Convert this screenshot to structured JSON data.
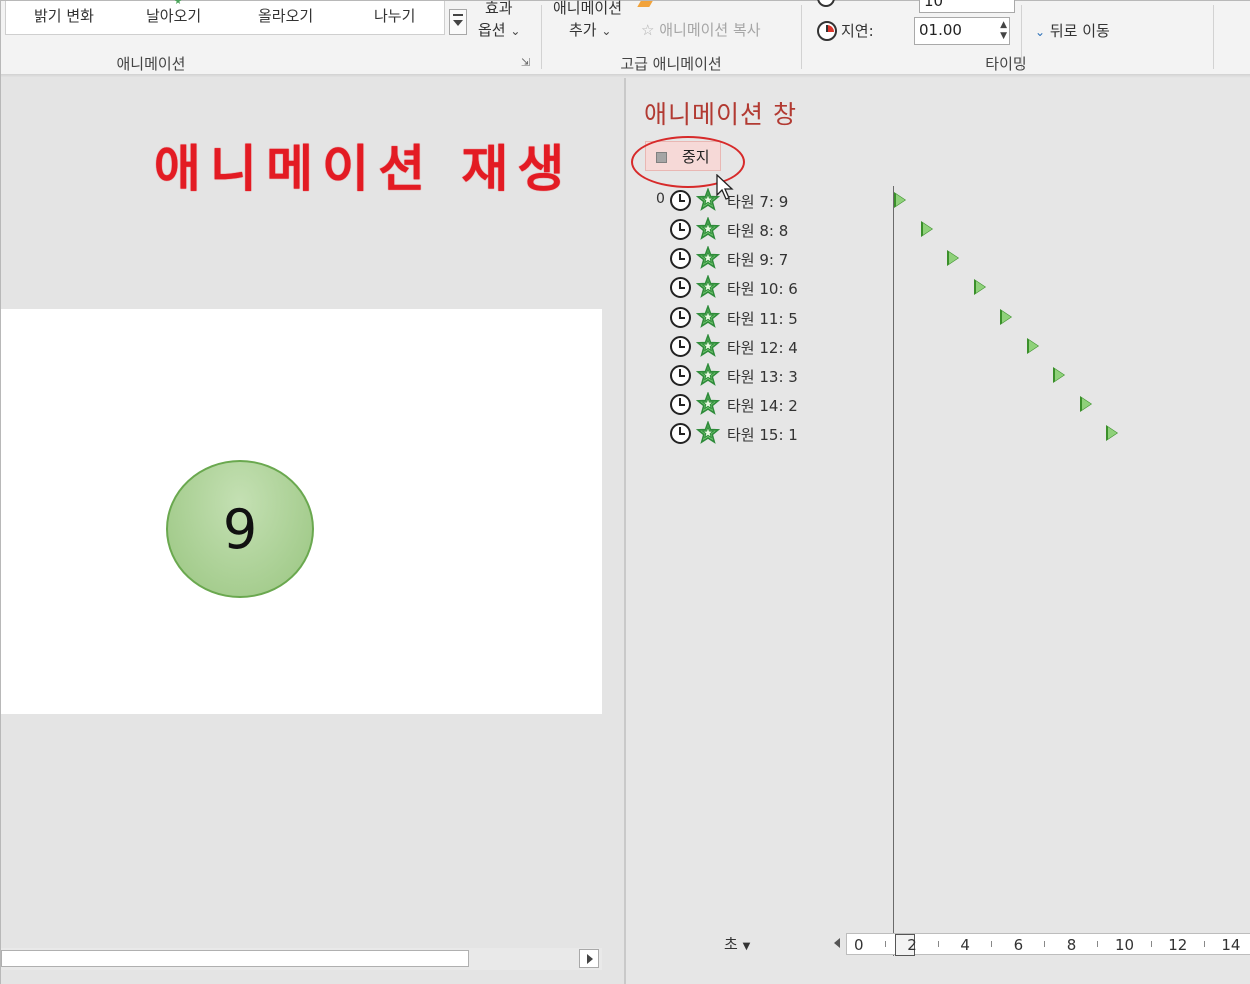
{
  "ribbon": {
    "gallery_items": [
      "밝기 변화",
      "날아오기",
      "올라오기",
      "나누기"
    ],
    "effect_options_line1": "효과",
    "effect_options_line2": "옵션",
    "animation_group_label": "애니메이션",
    "add_animation_line1": "애니메이션",
    "add_animation_line2": "추가",
    "animation_painter": "애니메이션 복사",
    "advanced_group_label": "고급 애니메이션",
    "delay_label": "지연:",
    "delay_value": "01.00",
    "duration_value": "10",
    "move_later": "뒤로 이동",
    "timing_group_label": "타이밍"
  },
  "slide": {
    "title": "애니메이션 재생",
    "circle_text": "9",
    "circle_fill": "#a9d18e",
    "circle_border": "#6aa84f"
  },
  "pane": {
    "title": "애니메이션 창",
    "stop_label": "중지",
    "first_row_number": "0",
    "rows": [
      {
        "label": "타원 7: 9",
        "start": 0
      },
      {
        "label": "타원 8: 8",
        "start": 1
      },
      {
        "label": "타원 9: 7",
        "start": 2
      },
      {
        "label": "타원 10: 6",
        "start": 3
      },
      {
        "label": "타원 11: 5",
        "start": 4
      },
      {
        "label": "타원 12: 4",
        "start": 5
      },
      {
        "label": "타원 13: 3",
        "start": 6
      },
      {
        "label": "타원 14: 2",
        "start": 7
      },
      {
        "label": "타원 15: 1",
        "start": 8
      }
    ],
    "seconds_label": "초",
    "ruler_labels": [
      "0",
      "2",
      "4",
      "6",
      "8",
      "10",
      "12",
      "14"
    ]
  },
  "colors": {
    "title_red": "#e31b23",
    "pane_title": "#b23a32",
    "highlight_ellipse": "#d72a2a",
    "effect_star": "#4caf50",
    "timeline_marker": "#8fd17a"
  },
  "icons": [
    "clock-icon",
    "effect-star-icon",
    "stop-icon",
    "painter-star-icon",
    "chevron-down-icon",
    "mouse-cursor-icon",
    "timeline-marker-icon"
  ]
}
